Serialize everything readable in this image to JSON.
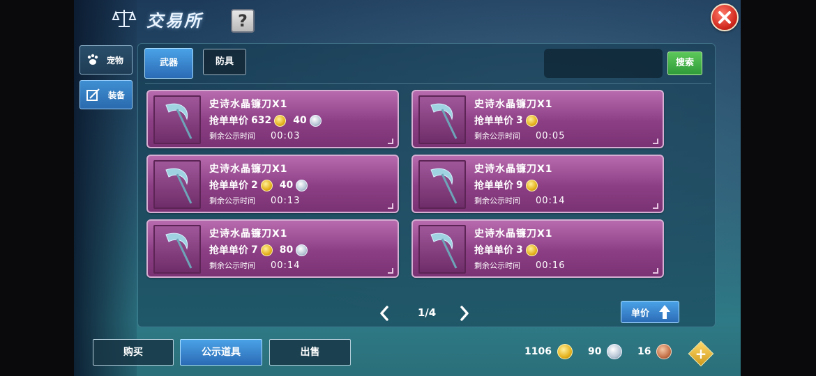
{
  "header": {
    "title": "交易所",
    "help_label": "?"
  },
  "sidebar": {
    "items": [
      {
        "label": "宠物",
        "icon": "paw-icon"
      },
      {
        "label": "装备",
        "icon": "equipment-icon"
      }
    ]
  },
  "tabs": [
    {
      "label": "武器"
    },
    {
      "label": "防具"
    }
  ],
  "search": {
    "placeholder": "",
    "button_label": "搜索"
  },
  "listings": [
    {
      "name": "史诗水晶镰刀X1",
      "price_label": "抢单单价",
      "gold": "632",
      "silver": "40",
      "time_label": "剩余公示时间",
      "time": "00:03"
    },
    {
      "name": "史诗水晶镰刀X1",
      "price_label": "抢单单价",
      "gold": "3",
      "silver": "",
      "time_label": "剩余公示时间",
      "time": "00:05"
    },
    {
      "name": "史诗水晶镰刀X1",
      "price_label": "抢单单价",
      "gold": "2",
      "silver": "40",
      "time_label": "剩余公示时间",
      "time": "00:13"
    },
    {
      "name": "史诗水晶镰刀X1",
      "price_label": "抢单单价",
      "gold": "9",
      "silver": "",
      "time_label": "剩余公示时间",
      "time": "00:14"
    },
    {
      "name": "史诗水晶镰刀X1",
      "price_label": "抢单单价",
      "gold": "7",
      "silver": "80",
      "time_label": "剩余公示时间",
      "time": "00:14"
    },
    {
      "name": "史诗水晶镰刀X1",
      "price_label": "抢单单价",
      "gold": "3",
      "silver": "",
      "time_label": "剩余公示时间",
      "time": "00:16"
    }
  ],
  "pagination": {
    "label": "1/4"
  },
  "sort": {
    "label": "单价"
  },
  "bottom_tabs": [
    {
      "label": "购买"
    },
    {
      "label": "公示道具"
    },
    {
      "label": "出售"
    }
  ],
  "currency": {
    "gold": "1106",
    "silver": "90",
    "bronze": "16"
  },
  "colors": {
    "card": "#8c3e84",
    "active_tab": "#2b6bb6",
    "search": "#2f9b3a",
    "close": "#d0281c"
  }
}
